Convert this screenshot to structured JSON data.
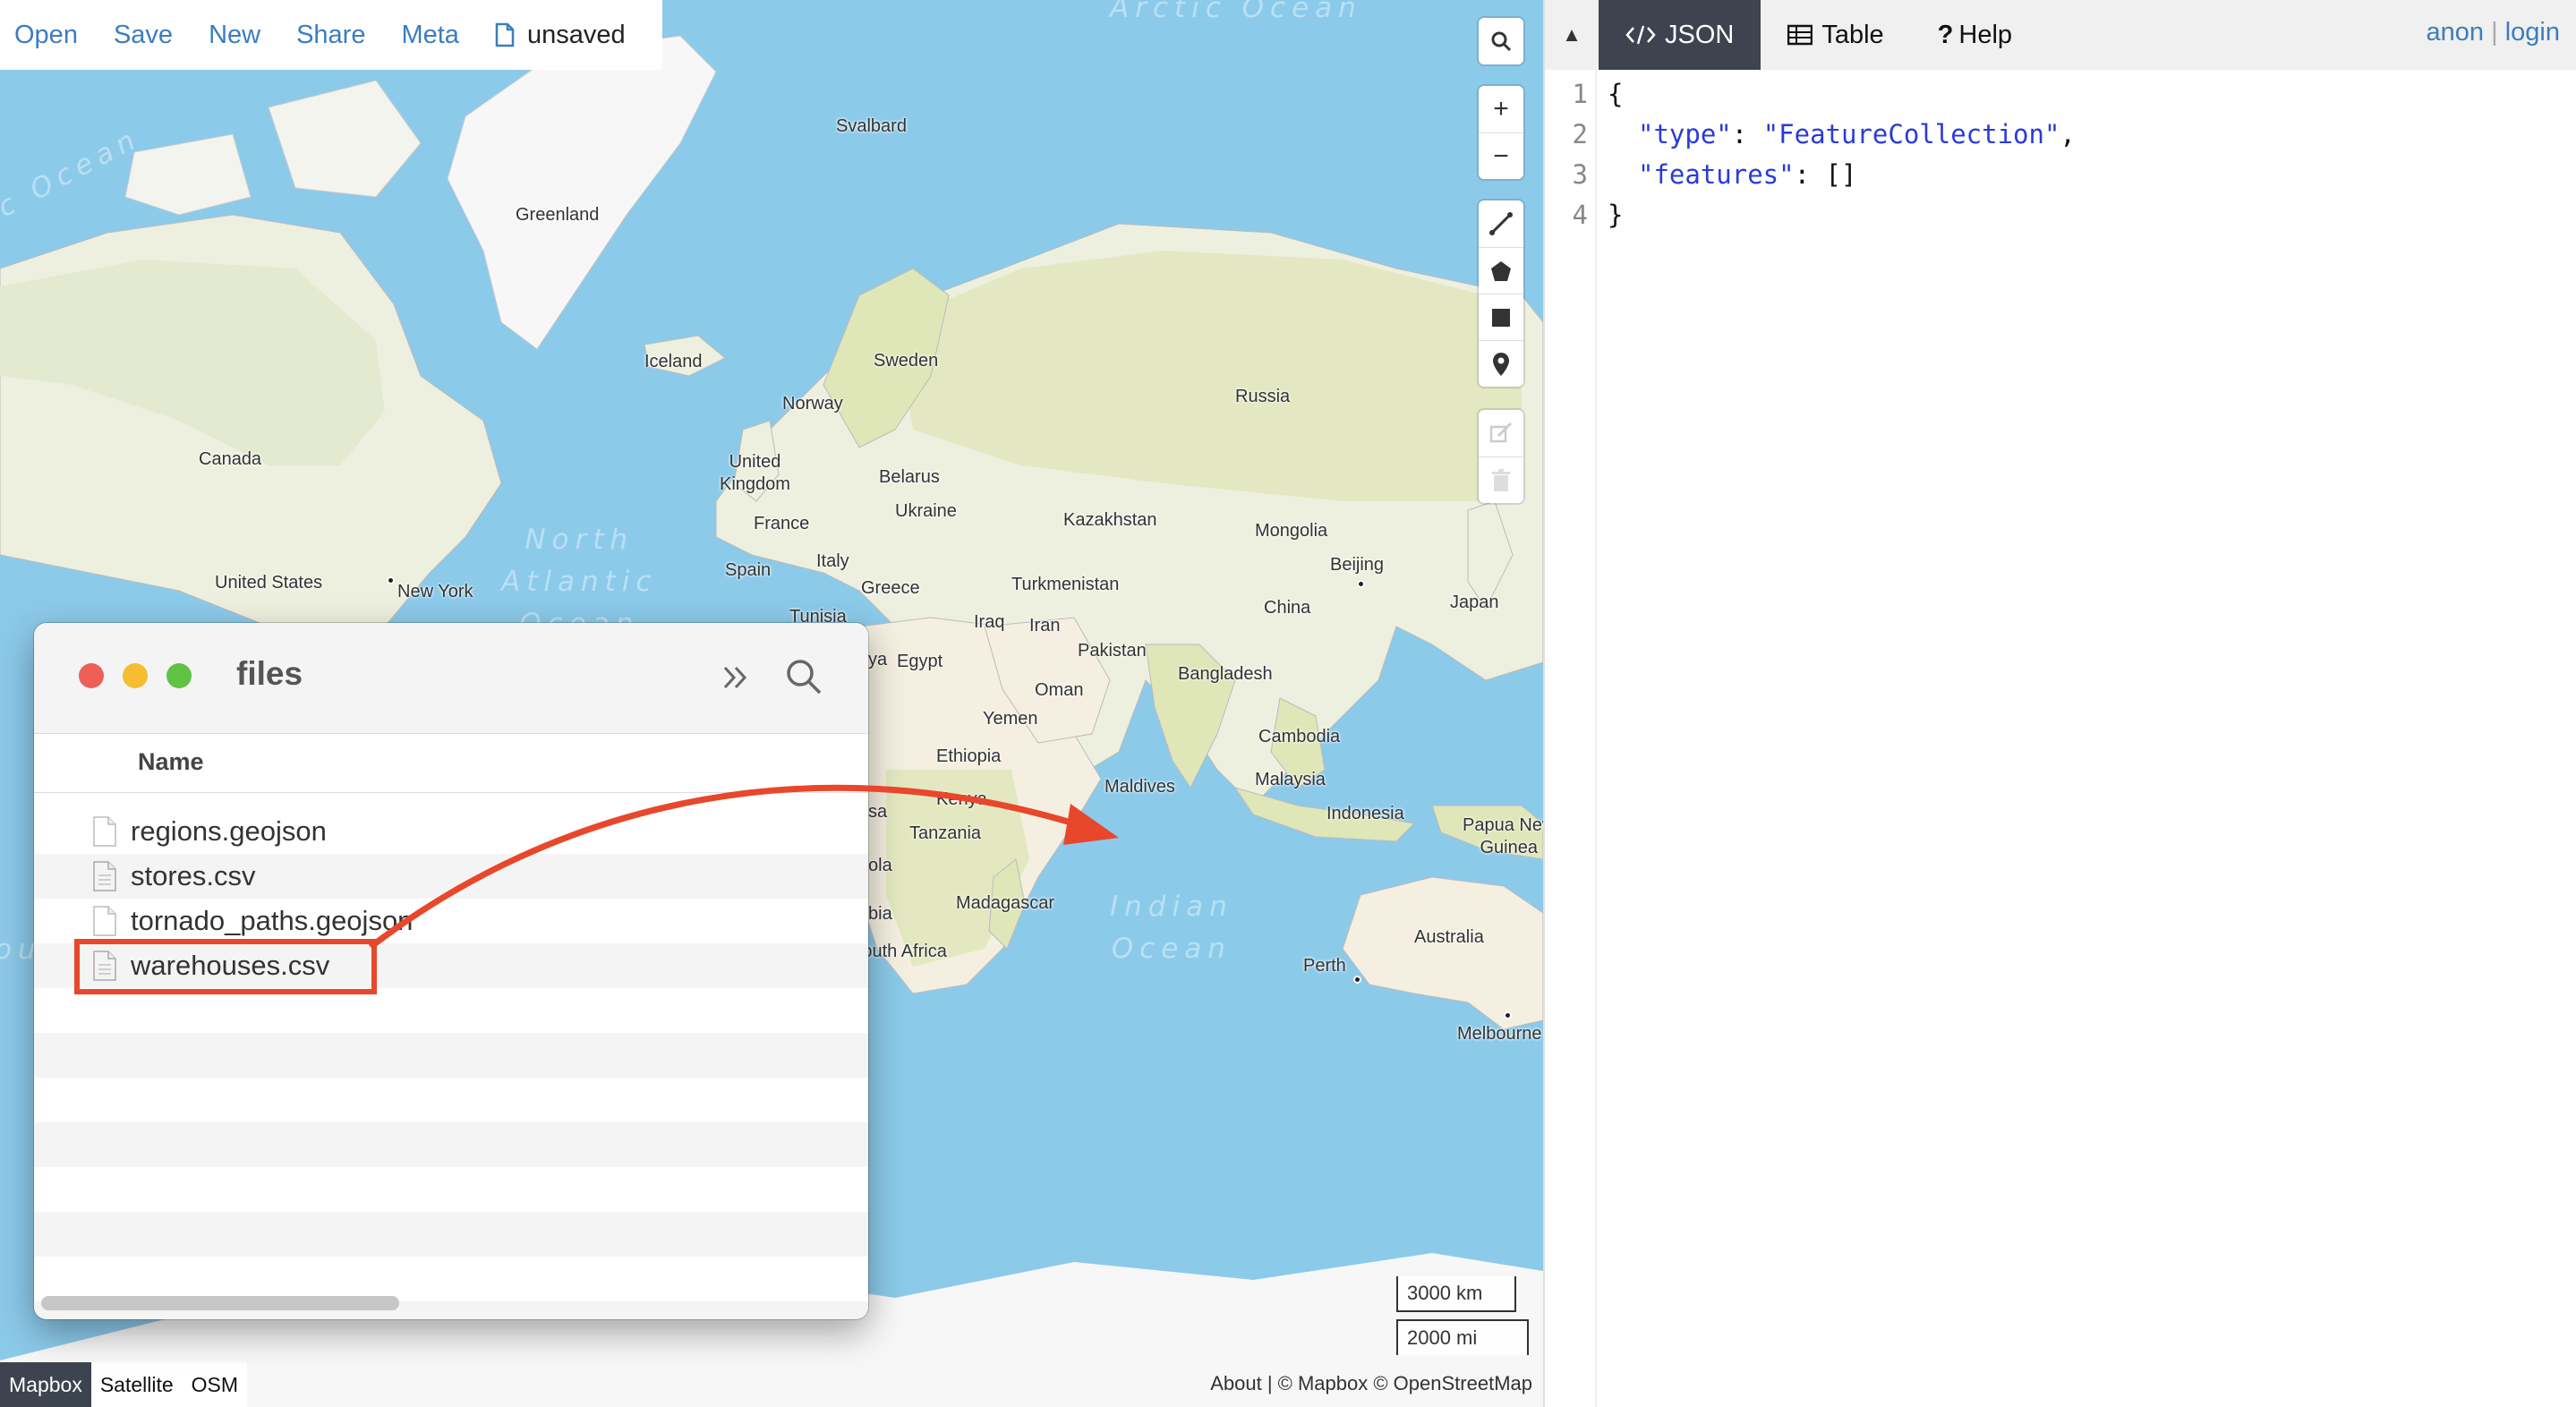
{
  "topmenu": {
    "open": "Open",
    "save": "Save",
    "new": "New",
    "share": "Share",
    "meta": "Meta",
    "doc_status": "unsaved"
  },
  "map": {
    "places": {
      "svalbard": "Svalbard",
      "greenland": "Greenland",
      "iceland": "Iceland",
      "sweden": "Sweden",
      "norway": "Norway",
      "russia": "Russia",
      "canada": "Canada",
      "uk": "United\nKingdom",
      "belarus": "Belarus",
      "ukraine": "Ukraine",
      "kazakhstan": "Kazakhstan",
      "mongolia": "Mongolia",
      "france": "France",
      "spain": "Spain",
      "italy": "Italy",
      "beijing": "Beijing",
      "japan": "Japan",
      "us": "United States",
      "newyork": "New York",
      "greece": "Greece",
      "turkmenistan": "Turkmenistan",
      "tunisia": "Tunisia",
      "iraq": "Iraq",
      "iran": "Iran",
      "china": "China",
      "pakistan": "Pakistan",
      "egypt": "Egypt",
      "bangladesh": "Bangladesh",
      "oman": "Oman",
      "yemen": "Yemen",
      "cambodia": "Cambodia",
      "ethiopia": "Ethiopia",
      "maldives": "Maldives",
      "malaysia": "Malaysia",
      "kenya": "Kenya",
      "indonesia": "Indonesia",
      "papua": "Papua New\nGuinea",
      "tanzania": "Tanzania",
      "madagascar": "Madagascar",
      "southafrica": "South Africa",
      "australia": "Australia",
      "perth": "Perth",
      "melbourne": "Melbourne",
      "ya": "ya",
      "sa": "sa",
      "ola": "ola",
      "bia": "bia"
    },
    "oceans": {
      "north_atlantic": "North\nAtlantic\nOcean",
      "indian": "Indian\nOcean",
      "arctic": "Arctic Ocean",
      "ocean_left": "c Ocean",
      "ou": "ou"
    },
    "scale": {
      "km": "3000 km",
      "mi": "2000 mi"
    },
    "styles": [
      "Mapbox",
      "Satellite",
      "OSM"
    ],
    "active_style": "Mapbox",
    "attribution": "About | © Mapbox © OpenStreetMap",
    "colors": {
      "water": "#8ccaea",
      "land": "#eef0df",
      "vegetation": "#dfe6b8",
      "desert": "#f4efe0",
      "ice": "#f7f7f7",
      "border": "#a9a9a9"
    }
  },
  "finder": {
    "title": "files",
    "column": "Name",
    "files": [
      "regions.geojson",
      "stores.csv",
      "tornado_paths.geojson",
      "warehouses.csv"
    ],
    "highlighted": "warehouses.csv",
    "annotation_color": "#e8472c"
  },
  "right": {
    "tabs": {
      "json": "JSON",
      "table": "Table",
      "help": "Help"
    },
    "user": {
      "name": "anon",
      "sep": "|",
      "login": "login"
    },
    "editor": {
      "line_numbers": [
        "1",
        "2",
        "3",
        "4"
      ],
      "l1": "{",
      "l2_key": "\"type\"",
      "l2_colon": ": ",
      "l2_val": "\"FeatureCollection\"",
      "l2_end": ",",
      "l3_key": "\"features\"",
      "l3_rest": ": []",
      "l4": "}"
    }
  }
}
